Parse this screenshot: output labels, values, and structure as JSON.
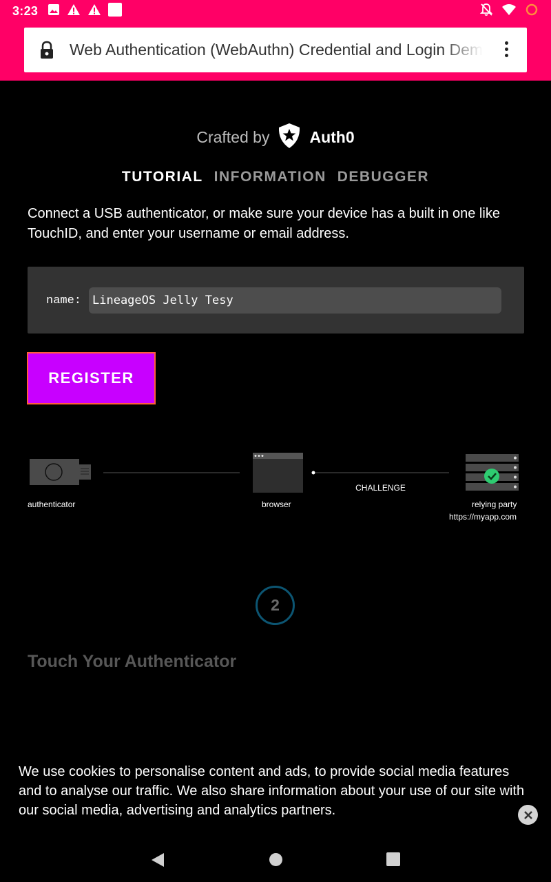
{
  "status_bar": {
    "time": "3:23",
    "left_icons": [
      "image-icon",
      "alert-icon",
      "alert-icon",
      "square-icon"
    ],
    "right_icons": [
      "bell-off-icon",
      "wifi-icon",
      "battery-ring-icon"
    ]
  },
  "browser": {
    "page_title": "Web Authentication (WebAuthn) Credential and Login Demo",
    "accent_color": "#ff0066"
  },
  "header": {
    "crafted_by": "Crafted by",
    "brand": "Auth0"
  },
  "tabs": [
    {
      "label": "TUTORIAL",
      "active": true
    },
    {
      "label": "INFORMATION",
      "active": false
    },
    {
      "label": "DEBUGGER",
      "active": false
    }
  ],
  "instructions": "Connect a USB authenticator, or make sure your device has a built in one like TouchID, and enter your username or email address.",
  "form": {
    "name_label": "name:",
    "name_value": "LineageOS Jelly Tesy",
    "register_label": "REGISTER",
    "register_color": "#c800ff"
  },
  "diagram": {
    "authenticator": "authenticator",
    "browser": "browser",
    "challenge": "CHALLENGE",
    "relying_party": "relying party",
    "relying_party_url": "https://myapp.com"
  },
  "step": {
    "number": "2",
    "title": "Touch Your Authenticator"
  },
  "cookie_banner": {
    "text": "We use cookies to personalise content and ads, to provide social media features and to analyse our traffic. We also share information about your use of our site with our social media, advertising and analytics partners."
  }
}
